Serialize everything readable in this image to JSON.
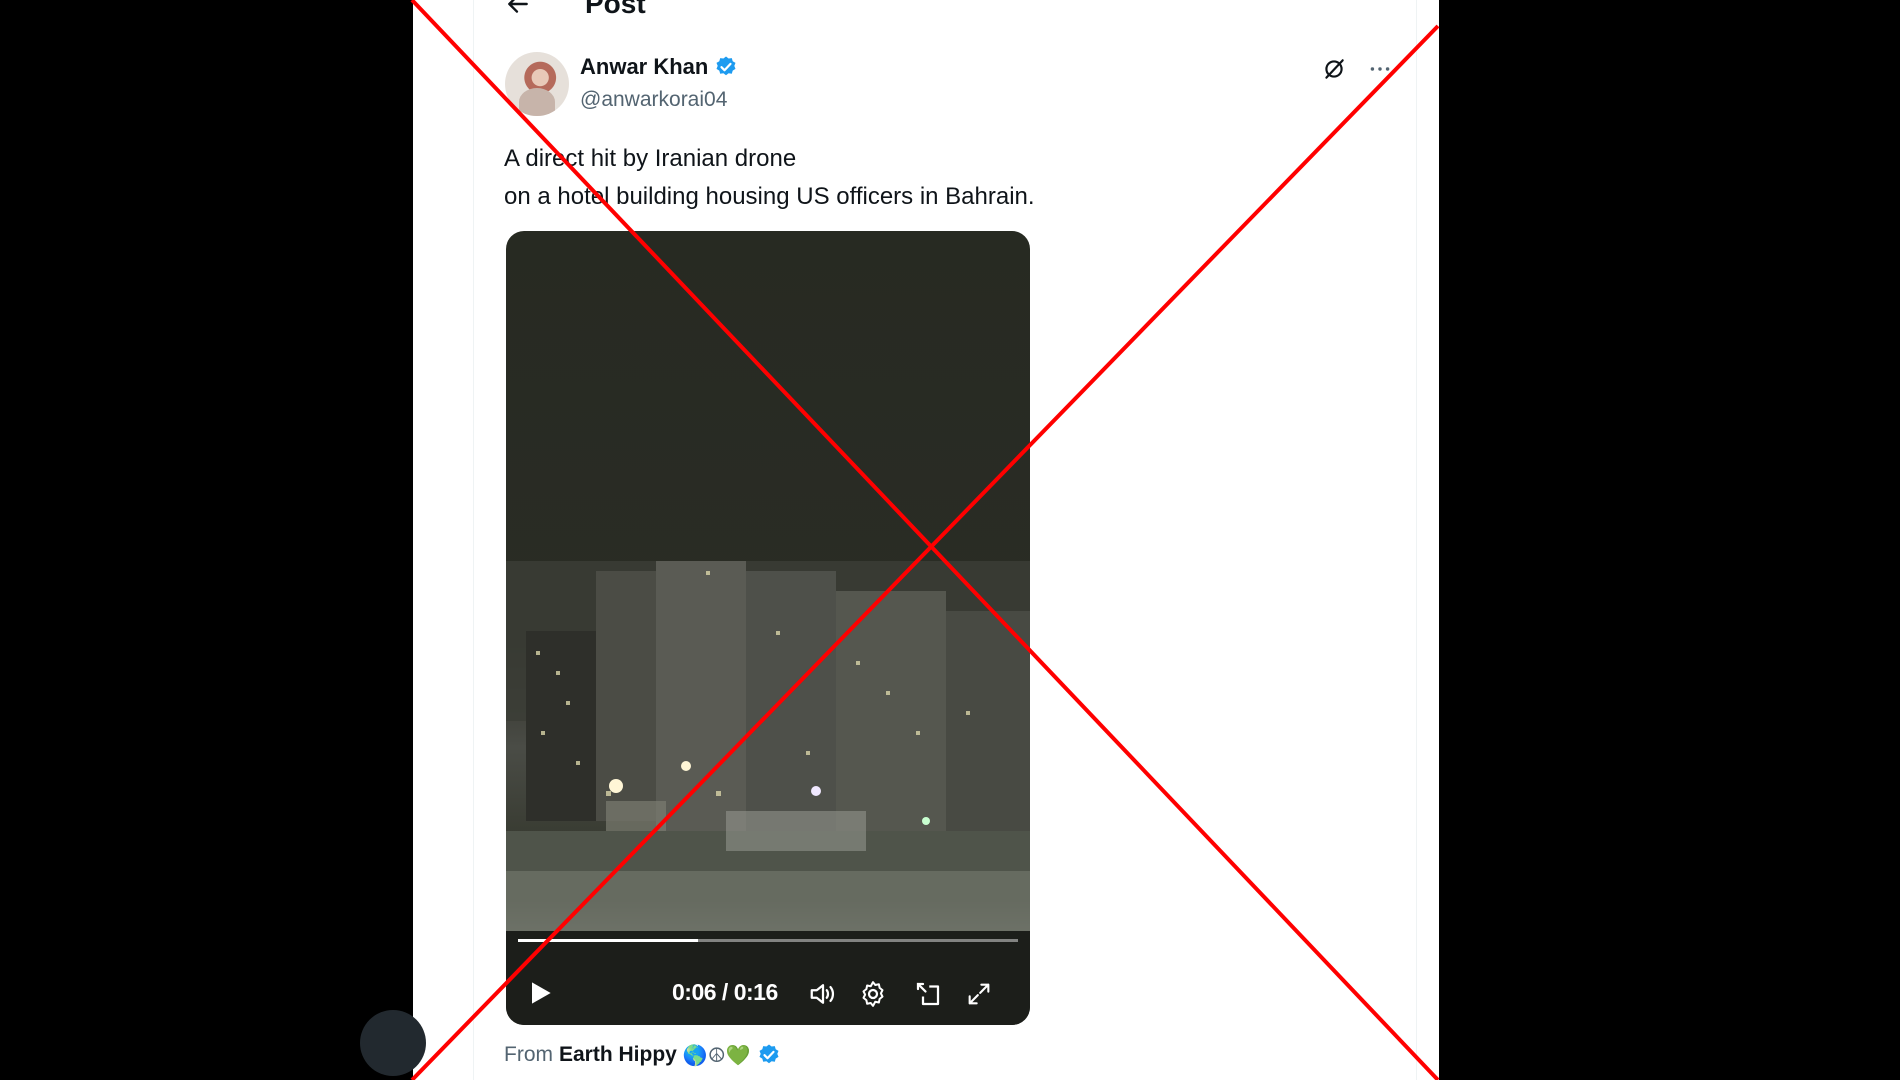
{
  "header": {
    "title": "Post"
  },
  "author": {
    "name": "Anwar Khan",
    "handle": "@anwarkorai04"
  },
  "post": {
    "text": "A direct hit by Iranian drone\non a hotel building housing US officers in Bahrain."
  },
  "video": {
    "time_label": "0:06 / 0:16",
    "progress": 0.36
  },
  "attribution": {
    "prefix": "From",
    "source_name": "Earth Hippy",
    "emojis": "🌎☮💚"
  },
  "colors": {
    "verified": "#1d9bf0",
    "cross": "#ff0000",
    "page_bg": "#000000"
  }
}
